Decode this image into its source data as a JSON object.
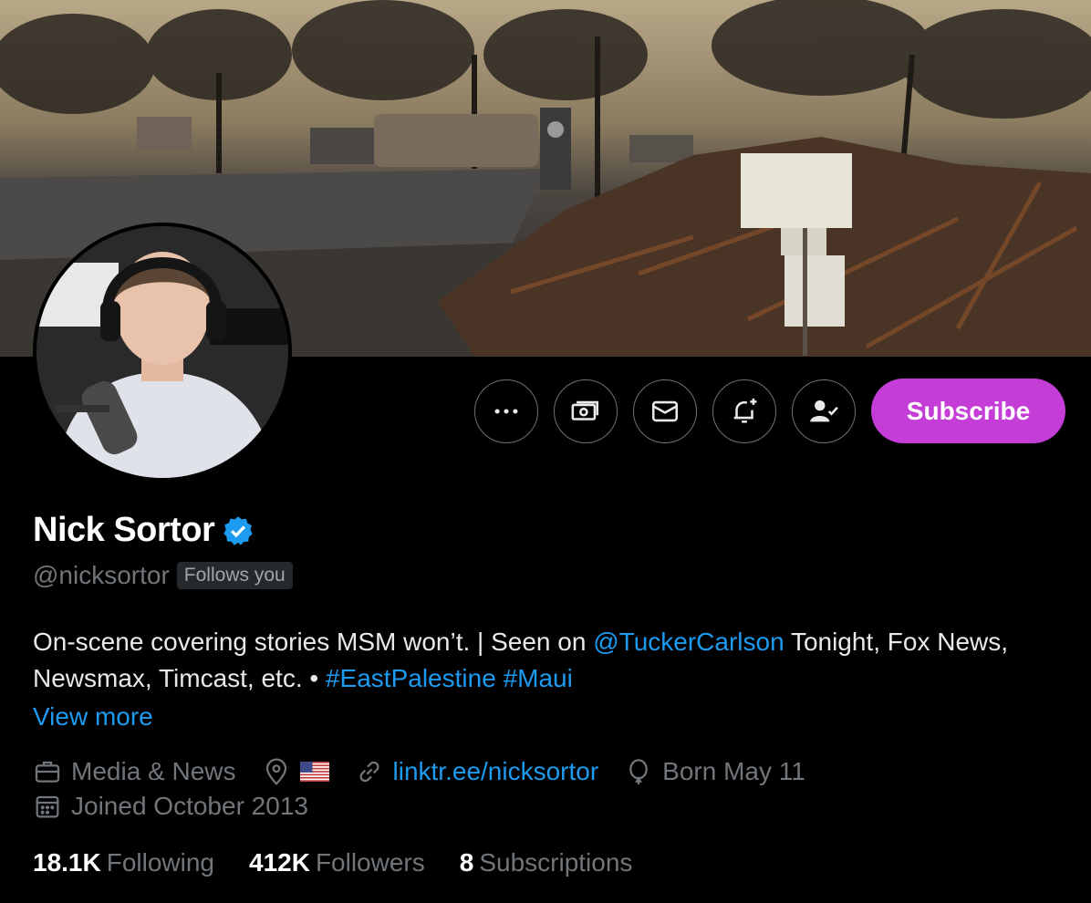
{
  "profile": {
    "name": "Nick Sortor",
    "handle": "@nicksortor",
    "follows_you": "Follows you",
    "bio": {
      "part1": "On-scene covering stories MSM won’t. | Seen on ",
      "mention": "@TuckerCarlson",
      "part2": " Tonight, Fox News, Newsmax, Timcast, etc. • ",
      "hashtag1": "#EastPalestine",
      "hashtag2": "#Maui"
    },
    "view_more": "View more",
    "category": "Media & News",
    "website": "linktr.ee/nicksortor",
    "born": "Born May 11",
    "joined": "Joined October 2013"
  },
  "actions": {
    "more_icon": "more-icon",
    "tip_icon": "money-icon",
    "message_icon": "envelope-icon",
    "notify_icon": "bell-plus-icon",
    "following_icon": "person-check-icon",
    "subscribe_label": "Subscribe"
  },
  "stats": {
    "following_count": "18.1K",
    "following_label": "Following",
    "followers_count": "412K",
    "followers_label": "Followers",
    "subscriptions_count": "8",
    "subscriptions_label": "Subscriptions"
  },
  "colors": {
    "accent": "#1d9bf0",
    "subscribe_bg": "#c33dd6",
    "verified": "#1d9bf0",
    "muted": "#71767b"
  }
}
